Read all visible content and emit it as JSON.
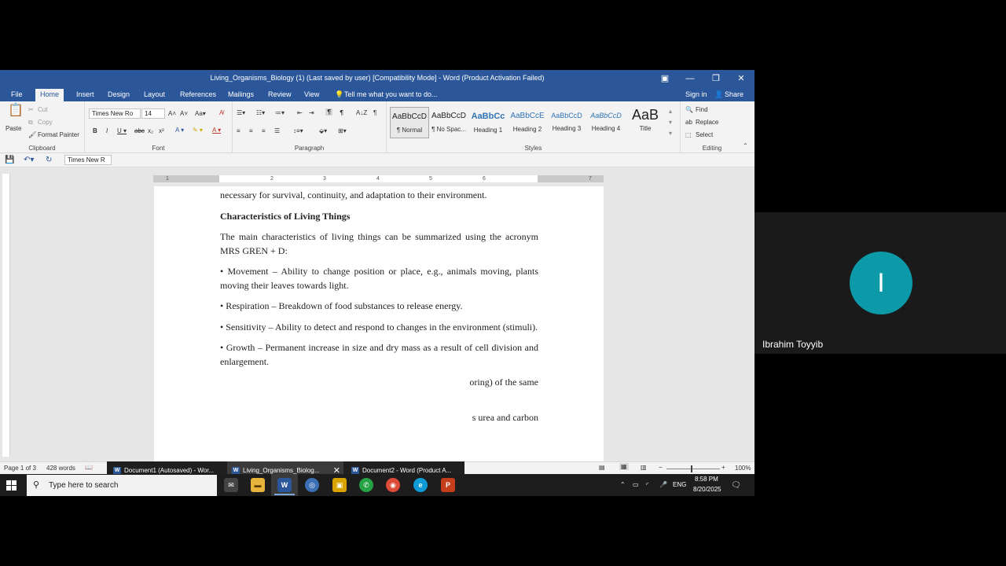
{
  "window": {
    "title": "Living_Organisms_Biology (1) (Last saved by user) [Compatibility Mode] - Word (Product Activation Failed)",
    "controls": {
      "ribbon_display": "▣",
      "minimize": "—",
      "restore": "❐",
      "close": "✕"
    }
  },
  "tabs": [
    "File",
    "Home",
    "Insert",
    "Design",
    "Layout",
    "References",
    "Mailings",
    "Review",
    "View"
  ],
  "active_tab": "Home",
  "tell_me": "Tell me what you want to do...",
  "sign_in": "Sign in",
  "share": "Share",
  "ribbon": {
    "clipboard": {
      "label": "Clipboard",
      "paste": "Paste",
      "cut": "Cut",
      "copy": "Copy",
      "format_painter": "Format Painter"
    },
    "font": {
      "label": "Font",
      "name": "Times New Ro",
      "size": "14"
    },
    "paragraph": {
      "label": "Paragraph"
    },
    "styles": {
      "label": "Styles",
      "items": [
        {
          "preview": "AaBbCcD",
          "name": "¶ Normal"
        },
        {
          "preview": "AaBbCcD",
          "name": "¶ No Spac..."
        },
        {
          "preview": "AaBbCc",
          "name": "Heading 1"
        },
        {
          "preview": "AaBbCcE",
          "name": "Heading 2"
        },
        {
          "preview": "AaBbCcD",
          "name": "Heading 3"
        },
        {
          "preview": "AaBbCcD",
          "name": "Heading 4"
        },
        {
          "preview": "AaB",
          "name": "Title"
        }
      ]
    },
    "editing": {
      "label": "Editing",
      "find": "Find",
      "replace": "Replace",
      "select": "Select"
    }
  },
  "qat": {
    "font_box": "Times New R"
  },
  "ruler": [
    "1",
    "2",
    "3",
    "4",
    "5",
    "6",
    "7"
  ],
  "document": {
    "paragraphs": [
      {
        "text": "necessary for survival, continuity, and adaptation to their environment.",
        "bold": false
      },
      {
        "text": "Characteristics of Living Things",
        "bold": true
      },
      {
        "text": "The main characteristics of living things can be summarized using the acronym MRS GREN + D:",
        "bold": false
      },
      {
        "text": "• Movement – Ability to change position or place, e.g., animals moving, plants moving their leaves towards light.",
        "bold": false
      },
      {
        "text": "• Respiration – Breakdown of food substances to release energy.",
        "bold": false
      },
      {
        "text": "• Sensitivity – Ability to detect and respond to changes in the environment (stimuli).",
        "bold": false
      },
      {
        "text": "• Growth – Permanent increase in size and dry mass as a result of cell division and enlargement.",
        "bold": false
      }
    ],
    "partial_line_1": "oring) of the same",
    "partial_line_2": "s urea and carbon"
  },
  "statusbar": {
    "page": "Page 1 of 3",
    "words": "428 words",
    "zoom": "100%"
  },
  "thumbnails": [
    {
      "title": "Document1 (Autosaved) - Wor..."
    },
    {
      "title": "Living_Organisms_Biolog..."
    },
    {
      "title": "Document2 - Word (Product A..."
    }
  ],
  "taskbar": {
    "search_placeholder": "Type here to search",
    "language": "ENG",
    "time": "8:58 PM",
    "date": "8/20/2025"
  },
  "participant": {
    "initial": "I",
    "name": "Ibrahim Toyyib"
  }
}
